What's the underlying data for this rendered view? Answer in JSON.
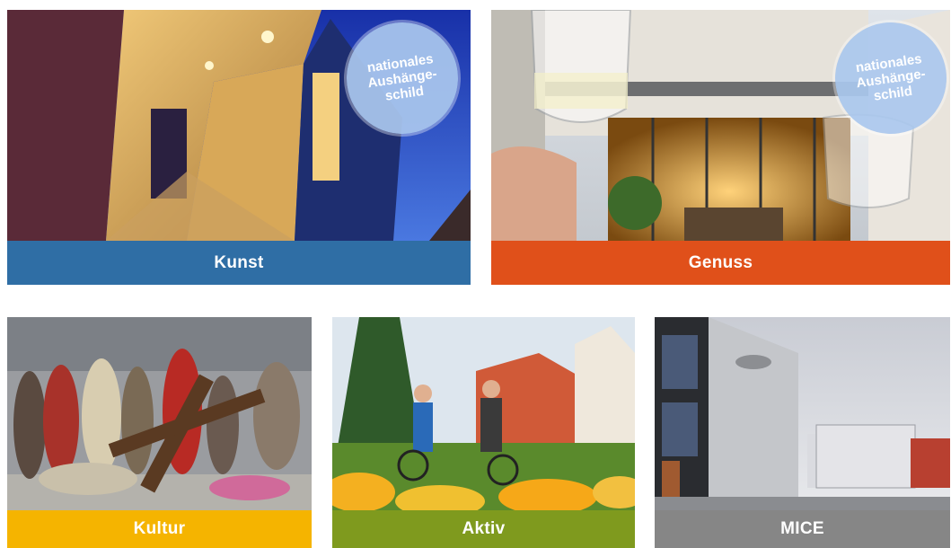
{
  "tiles": {
    "kunst": {
      "label": "Kunst",
      "color": "#2f6ea5",
      "badge": {
        "line1": "nationales",
        "line2": "Aushänge-",
        "line3": "schild"
      }
    },
    "genuss": {
      "label": "Genuss",
      "color": "#e0501a",
      "badge": {
        "line1": "nationales",
        "line2": "Aushänge-",
        "line3": "schild"
      }
    },
    "kultur": {
      "label": "Kultur",
      "color": "#f5b400"
    },
    "aktiv": {
      "label": "Aktiv",
      "color": "#7f9a1e"
    },
    "mice": {
      "label": "MICE",
      "color": "#868686"
    }
  }
}
